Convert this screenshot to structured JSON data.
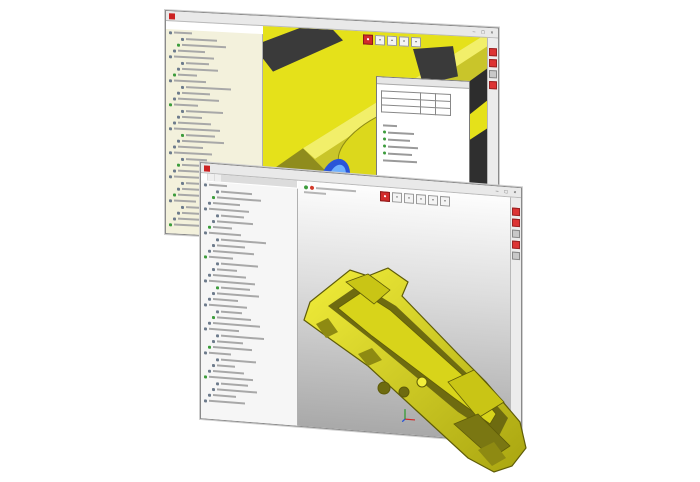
{
  "back_window": {
    "app_badge": "",
    "controls": [
      "–",
      "□",
      "×"
    ],
    "tree_rows": [
      "",
      "",
      "",
      "",
      "",
      "",
      "",
      "",
      "",
      "",
      "",
      "",
      "",
      "",
      "",
      "",
      "",
      "",
      "",
      "",
      "",
      "",
      "",
      "",
      "",
      "",
      "",
      "",
      "",
      "",
      "",
      "",
      ""
    ],
    "viewport_color": "#e5e11a",
    "tool_icons": [
      "record-icon",
      "move-icon",
      "measure-icon",
      "align-icon",
      "settings-icon"
    ]
  },
  "front_window": {
    "app_badge": "",
    "controls": [
      "–",
      "□",
      "×"
    ],
    "tabs": [
      "",
      "",
      ""
    ],
    "tree_rows": [
      "",
      "",
      "",
      "",
      "",
      "",
      "",
      "",
      "",
      "",
      "",
      "",
      "",
      "",
      "",
      "",
      "",
      "",
      "",
      "",
      "",
      "",
      "",
      "",
      "",
      "",
      "",
      "",
      "",
      "",
      "",
      "",
      "",
      "",
      "",
      "",
      ""
    ],
    "tool_icons": [
      "record-icon",
      "move-icon",
      "measure-icon",
      "align-icon",
      "cube-icon",
      "settings-icon"
    ]
  },
  "colors": {
    "part_yellow": "#e1dc1c",
    "accent_red": "#d22a2a",
    "status_green": "#3c9c3c",
    "deviation_blue": "#2a55d8"
  }
}
